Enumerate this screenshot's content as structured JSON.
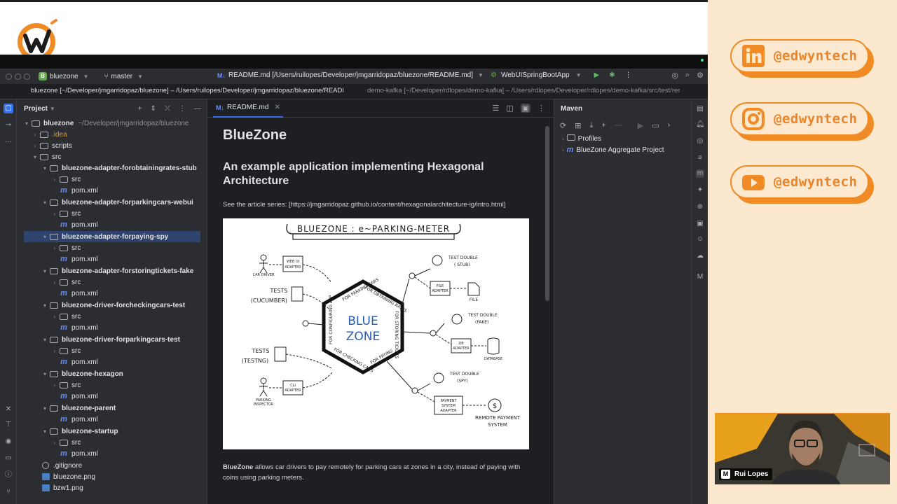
{
  "ide": {
    "project_name": "bluezone",
    "branch": "master",
    "file_title": "README.md [/Users/ruilopes/Developer/jmgarridopaz/bluezone/README.md]",
    "run_config": "WebUISpringBootApp",
    "path_tab_active": "bluezone [~/Developer/jmgarridopaz/bluezone] – /Users/ruilopes/Developer/jmgarridopaz/bluezone/README.md",
    "path_tab_inactive": "demo-kafka [~/Developer/rdlopes/demo-kafka] – /Users/rdlopes/Developer/rdlopes/demo-kafka/src/test/resources"
  },
  "project_pane": {
    "title": "Project",
    "tree": [
      {
        "label": "bluezone",
        "sub": "~/Developer/jmgarridopaz/bluezone"
      },
      {
        "label": ".idea"
      },
      {
        "label": "scripts"
      },
      {
        "label": "src"
      },
      {
        "label": "bluezone-adapter-forobtainingrates-stub"
      },
      {
        "label": "src"
      },
      {
        "label": "pom.xml"
      },
      {
        "label": "bluezone-adapter-forparkingcars-webui"
      },
      {
        "label": "src"
      },
      {
        "label": "pom.xml"
      },
      {
        "label": "bluezone-adapter-forpaying-spy"
      },
      {
        "label": "src"
      },
      {
        "label": "pom.xml"
      },
      {
        "label": "bluezone-adapter-forstoringtickets-fake"
      },
      {
        "label": "src"
      },
      {
        "label": "pom.xml"
      },
      {
        "label": "bluezone-driver-forcheckingcars-test"
      },
      {
        "label": "src"
      },
      {
        "label": "pom.xml"
      },
      {
        "label": "bluezone-driver-forparkingcars-test"
      },
      {
        "label": "src"
      },
      {
        "label": "pom.xml"
      },
      {
        "label": "bluezone-hexagon"
      },
      {
        "label": "src"
      },
      {
        "label": "pom.xml"
      },
      {
        "label": "bluezone-parent"
      },
      {
        "label": "pom.xml"
      },
      {
        "label": "bluezone-startup"
      },
      {
        "label": "src"
      },
      {
        "label": "pom.xml"
      },
      {
        "label": ".gitignore"
      },
      {
        "label": "bluezone.png"
      },
      {
        "label": "bzw1.png"
      }
    ]
  },
  "editor": {
    "tab_label": "README.md",
    "h1": "BlueZone",
    "h2": "An example application implementing Hexagonal Architecture",
    "article_line": "See the article series: [https://jmgarridopaz.github.io/content/hexagonalarchitecture-ig/intro.html]",
    "para_bold": "BlueZone",
    "para_rest": " allows car drivers to pay remotely for parking cars at zones in a city, instead of paying with coins using parking meters.",
    "diagram": {
      "title": "BLUEZONE : e~PARKING-METER",
      "center": [
        "BLUE",
        "ZONE"
      ],
      "labels": {
        "car_driver": "CAR DRIVER",
        "webui": "WEB UI",
        "adapter": "ADAPTER",
        "tests_cucumber_a": "TESTS",
        "tests_cucumber_b": "(CUCUMBER)",
        "tests_testng_a": "TESTS",
        "tests_testng_b": "(TESTNG)",
        "parking_a": "PARKING",
        "parking_b": "INSPECTOR",
        "cli": "CLI",
        "td_stub_a": "TEST DOUBLE",
        "td_stub_b": "( STUB)",
        "file_adapter_a": "FILE",
        "file": "FILE",
        "td_fake_a": "TEST DOUBLE",
        "td_fake_b": "(FAKE)",
        "db": "DB",
        "database": "DATABASE",
        "td_spy_a": "TEST DOUBLE",
        "td_spy_b": "(SPY)",
        "payment_a": "PAYMENT",
        "payment_b": "SYSTEM",
        "remote_a": "REMOTE PAYMENT",
        "remote_b": "SYSTEM",
        "port_parking": "FOR PARKING CARS",
        "port_rates": "FOR OBTAINING RATES",
        "port_config": "FOR CONFIGURING APP",
        "port_storing": "FOR STORING TICKETS",
        "port_checking": "FOR CHECKING CARS",
        "port_paying": "FOR PAYING",
        "dollar": "$"
      }
    }
  },
  "maven": {
    "title": "Maven",
    "items": [
      "Profiles",
      "BlueZone Aggregate Project"
    ]
  },
  "socials": [
    {
      "network": "linkedin-icon",
      "handle": "@edwyntech"
    },
    {
      "network": "instagram-icon",
      "handle": "@edwyntech"
    },
    {
      "network": "youtube-icon",
      "handle": "@edwyntech"
    }
  ],
  "webcam": {
    "badge": "M",
    "name": "Rui Lopes"
  },
  "colors": {
    "accent": "#f08a24",
    "ide_bg": "#1e1f22",
    "selection": "#2e436e",
    "ide_blue": "#3574f0"
  }
}
